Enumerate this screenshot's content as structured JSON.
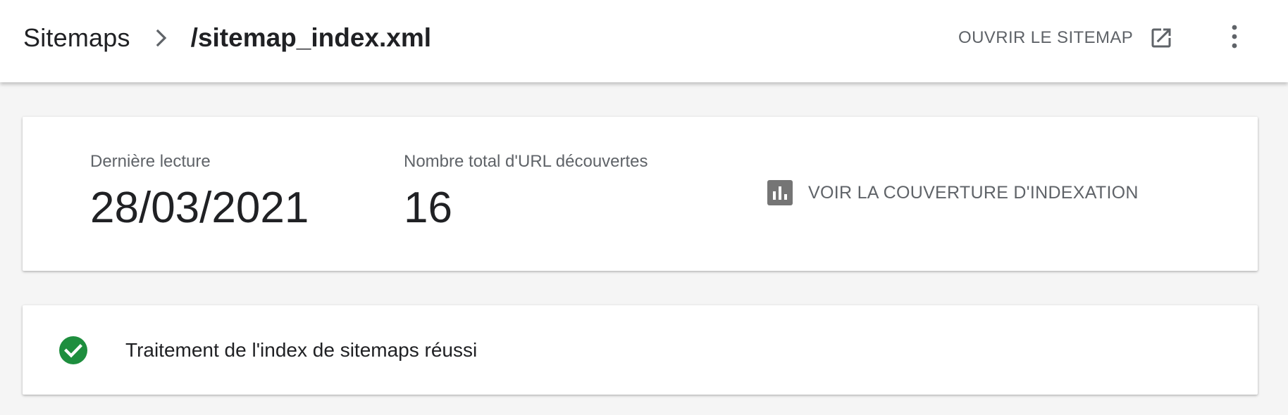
{
  "header": {
    "breadcrumb_root": "Sitemaps",
    "breadcrumb_current": "/sitemap_index.xml",
    "open_sitemap_label": "OUVRIR LE SITEMAP"
  },
  "summary": {
    "last_read_label": "Dernière lecture",
    "last_read_value": "28/03/2021",
    "total_urls_label": "Nombre total d'URL découvertes",
    "total_urls_value": "16",
    "coverage_link_label": "VOIR LA COUVERTURE D'INDEXATION"
  },
  "status": {
    "message": "Traitement de l'index de sitemaps réussi",
    "icon": "check-circle-icon",
    "color": "#1e8e3e"
  },
  "icons": {
    "breadcrumb_separator": "chevron-right-icon",
    "open_sitemap": "open-in-new-icon",
    "more": "more-vert-icon",
    "coverage": "bar-chart-icon"
  },
  "colors": {
    "header_background": "#ffffff",
    "page_background": "#f5f5f5",
    "primary_text": "#202124",
    "secondary_text": "#5f6368",
    "success": "#1e8e3e"
  }
}
